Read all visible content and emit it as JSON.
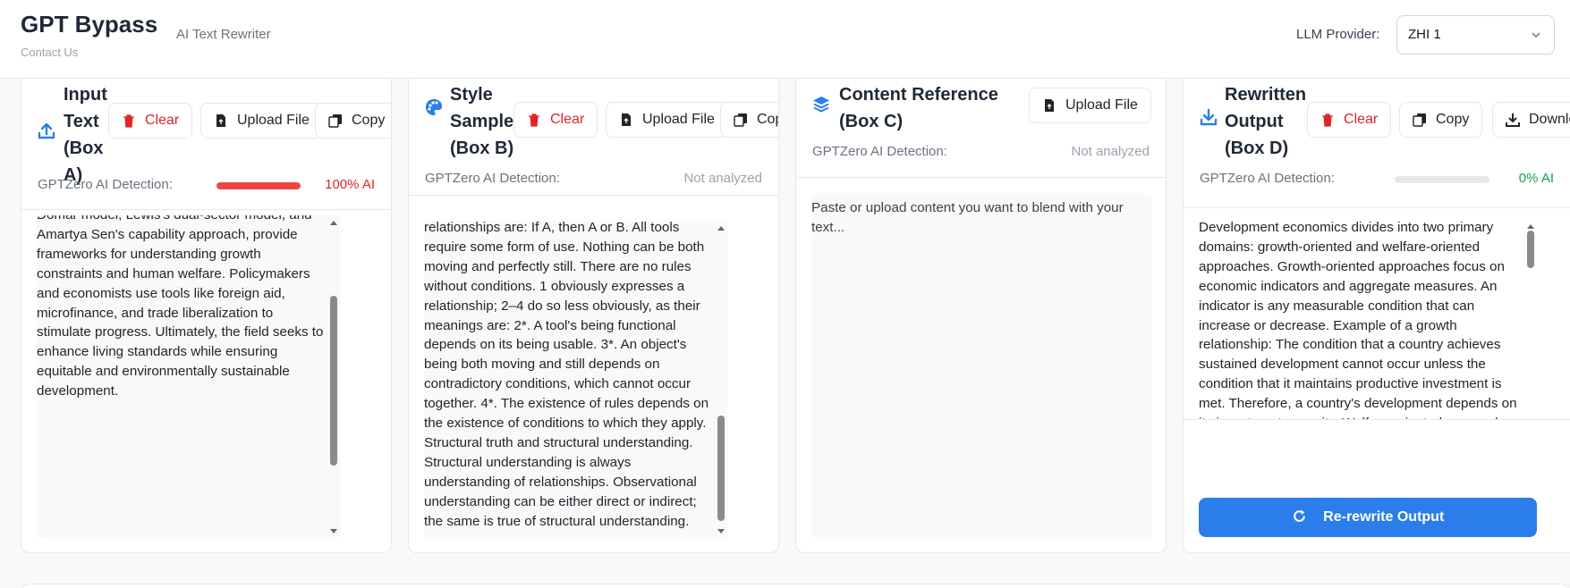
{
  "header": {
    "brand": "GPT Bypass",
    "subtitle": "AI Text Rewriter",
    "contact": "Contact Us",
    "provider_label": "LLM Provider:",
    "provider_value": "ZHI 1"
  },
  "detection_label": "GPTZero AI Detection:",
  "colors": {
    "accent": "#2b7de9",
    "danger": "#dc2626",
    "success": "#16a34a"
  },
  "panel_a": {
    "title_lines": [
      "Input",
      "Text",
      "(Box",
      "A)"
    ],
    "icon": "upload-icon",
    "clear": "Clear",
    "upload": "Upload File",
    "copy": "Copy",
    "detection_value": "100% AI",
    "detection_fraction": 1.0,
    "text": "Development economics is a branch of economics that focuses on improving fiscal, economic, and social conditions in developing countries. It examines factors such as poverty, education, health, infrastructure, and sustainable growth to design policies that promote long-term development. Unlike traditional economics, development economics considers unique challenges like institutional weaknesses, market failures, and global disparities. Key theories, such as the Harrod-Domar model, Lewis's dual-sector model, and Amartya Sen's capability approach, provide frameworks for understanding growth constraints and human welfare. Policymakers and economists use tools like foreign aid, microfinance, and trade liberalization to stimulate progress. Ultimately, the field seeks to enhance living standards while ensuring equitable and environmentally sustainable development."
  },
  "panel_b": {
    "title_lines": [
      "Style",
      "Sample",
      "(Box B)"
    ],
    "icon": "palette-icon",
    "clear": "Clear",
    "upload": "Upload File",
    "copy": "Copy",
    "detection_value": "Not analyzed",
    "text": "relationships are: If A, then A or B. All tools require some form of use. Nothing can be both moving and perfectly still. There are no rules without conditions. 1 obviously expresses a relationship; 2–4 do so less obviously, as their meanings are: 2*. A tool's being functional depends on its being usable. 3*. An object's being both moving and still depends on contradictory conditions, which cannot occur together. 4*. The existence of rules depends on the existence of conditions to which they apply. Structural truth and structural understanding. Structural understanding is always understanding of relationships. Observational understanding can be either direct or indirect; the same is true of structural understanding."
  },
  "panel_c": {
    "title_lines": [
      "Content Reference",
      "(Box C)"
    ],
    "icon": "layers-icon",
    "upload": "Upload File",
    "detection_value": "Not analyzed",
    "placeholder": "Paste or upload content you want to blend with your text..."
  },
  "panel_d": {
    "title_lines": [
      "Rewritten",
      "Output",
      "(Box D)"
    ],
    "icon": "download-icon",
    "clear": "Clear",
    "copy": "Copy",
    "download": "Download",
    "detection_value": "0% AI",
    "detection_fraction": 0.0,
    "text": "Development economics divides into two primary domains: growth-oriented and welfare-oriented approaches. Growth-oriented approaches focus on economic indicators and aggregate measures. An indicator is any measurable condition that can increase or decrease. Example of a growth relationship: The condition that a country achieves sustained development cannot occur unless the condition that it maintains productive investment is met. Therefore, a country's development depends on its investment capacity. Welfare-oriented approaches focus on human conditions and social outcomes. (A social outcome is any state of human well-being.)",
    "rewrite_button": "Re-rewrite Output"
  }
}
